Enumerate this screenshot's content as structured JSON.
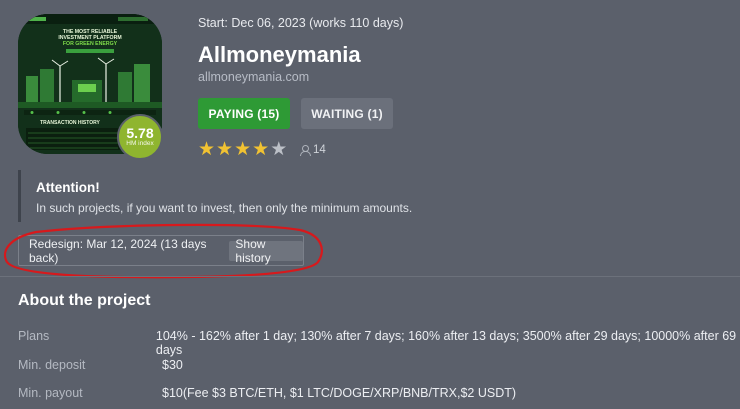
{
  "project": {
    "start": "Start: Dec 06, 2023 (works 110 days)",
    "name": "Allmoneymania",
    "domain": "allmoneymania.com",
    "score": "5.78",
    "score_label": "HM index",
    "paying_label": "PAYING (15)",
    "waiting_label": "WAITING (1)",
    "rating": 4,
    "rating_max": 5,
    "votes": "14",
    "colors": {
      "paying": "#2e9a35",
      "score": "#8fb52f",
      "star": "#f1c232",
      "annotation": "#d7191c"
    }
  },
  "attention": {
    "title": "Attention!",
    "text": "In such projects, if you want to invest, then only the minimum amounts."
  },
  "redesign": {
    "text": "Redesign: Mar 12, 2024 (13 days back)",
    "history_label": "Show history"
  },
  "about": {
    "title": "About the project",
    "rows": [
      {
        "label": "Plans",
        "value": "104% - 162% after 1 day; 130% after 7 days; 160% after 13 days; 3500% after 29 days; 10000% after 69 days"
      },
      {
        "label": "Min. deposit",
        "value": "$30"
      },
      {
        "label": "Min. payout",
        "value": "$10(Fee $3 BTC/ETH, $1 LTC/DOGE/XRP/BNB/TRX,$2 USDT)"
      }
    ]
  },
  "screenshot_text": {
    "headline_1": "THE MOST RELIABLE",
    "headline_2": "INVESTMENT PLATFORM",
    "headline_3": "FOR GREEN ENERGY",
    "section": "TRANSACTION HISTORY"
  }
}
